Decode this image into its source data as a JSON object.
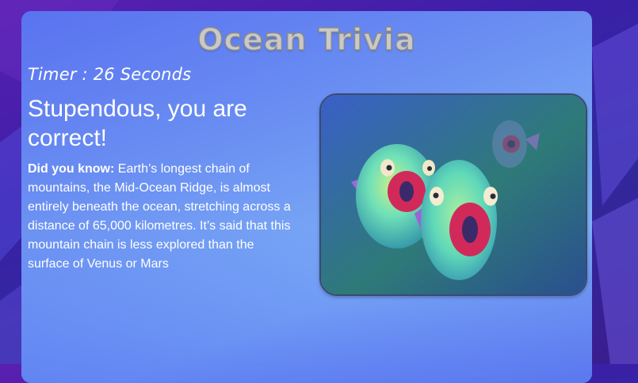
{
  "app": {
    "title": "Ocean Trivia",
    "timer": "Timer : 26 Seconds"
  },
  "result": {
    "headline": "Stupendous, you are correct!",
    "fact_label": "Did you know:",
    "fact_text": " Earth’s longest chain of mountains, the Mid-Ocean Ridge, is almost entirely beneath the ocean, stretching across a distance of 65,000 kilometres. It’s said that this mountain chain is less explored than the surface of Venus or Mars"
  },
  "image": {
    "icon": "surprised-fish-illustration"
  },
  "colors": {
    "card_top": "#5a72f0",
    "card_mid": "#7fb2f7",
    "background": "#3b1fa8",
    "title": "#c9c9c9"
  }
}
